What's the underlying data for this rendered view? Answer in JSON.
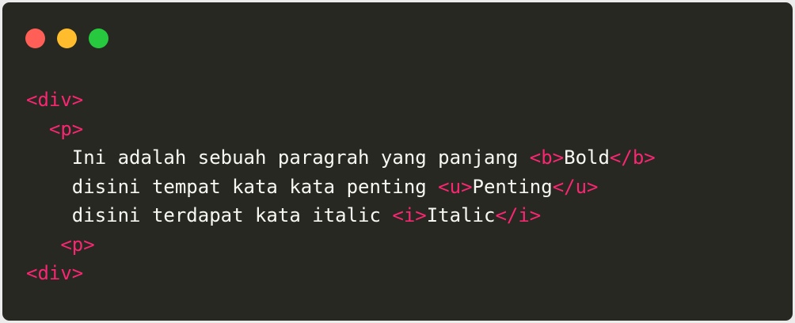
{
  "colors": {
    "background": "#272822",
    "tag": "#f92672",
    "text": "#f8f8f2",
    "dot_red": "#ff5f56",
    "dot_yellow": "#ffbd2e",
    "dot_green": "#27c93f"
  },
  "window_controls": [
    "close",
    "minimize",
    "maximize"
  ],
  "code_lines": [
    {
      "indent": "",
      "segments": [
        {
          "kind": "tag",
          "text": "<div>"
        }
      ]
    },
    {
      "indent": "  ",
      "segments": [
        {
          "kind": "tag",
          "text": "<p>"
        }
      ]
    },
    {
      "indent": "    ",
      "segments": [
        {
          "kind": "text",
          "text": "Ini adalah sebuah paragrah yang panjang "
        },
        {
          "kind": "tag",
          "text": "<b>"
        },
        {
          "kind": "text",
          "text": "Bold"
        },
        {
          "kind": "tag",
          "text": "</b>"
        }
      ]
    },
    {
      "indent": "    ",
      "segments": [
        {
          "kind": "text",
          "text": "disini tempat kata kata penting "
        },
        {
          "kind": "tag",
          "text": "<u>"
        },
        {
          "kind": "text",
          "text": "Penting"
        },
        {
          "kind": "tag",
          "text": "</u>"
        }
      ]
    },
    {
      "indent": "    ",
      "segments": [
        {
          "kind": "text",
          "text": "disini terdapat kata italic "
        },
        {
          "kind": "tag",
          "text": "<i>"
        },
        {
          "kind": "text",
          "text": "Italic"
        },
        {
          "kind": "tag",
          "text": "</i>"
        }
      ]
    },
    {
      "indent": "   ",
      "segments": [
        {
          "kind": "tag",
          "text": "<p>"
        }
      ]
    },
    {
      "indent": "",
      "segments": [
        {
          "kind": "tag",
          "text": "<div>"
        }
      ]
    }
  ]
}
